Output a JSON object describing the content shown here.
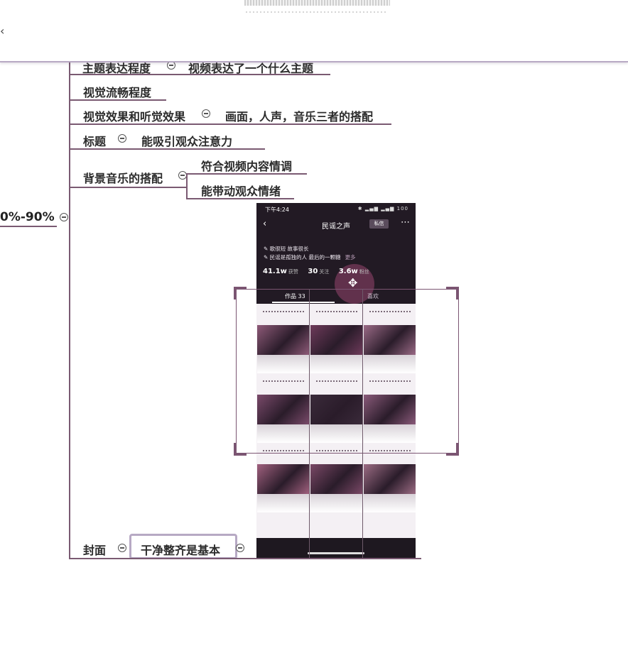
{
  "toolbar": {
    "back_glyph": "‹"
  },
  "mindmap": {
    "root_label": "0%-90%",
    "items": [
      {
        "label": "主题表达程度",
        "child": "视频表达了一个什么主题"
      },
      {
        "label": "视觉流畅程度"
      },
      {
        "label": "视觉效果和听觉效果",
        "child": "画面，人声，音乐三者的搭配"
      },
      {
        "label": "标题",
        "child": "能吸引观众注意力"
      },
      {
        "label": "背景音乐的搭配",
        "children": [
          "符合视频内容情调",
          "能带动观众情绪"
        ]
      },
      {
        "label": "封面",
        "child": "干净整齐是基本"
      }
    ]
  },
  "phone": {
    "status_time": "下午4:24",
    "status_icons": "✱ ▂▄▆ ▂▄▆ 100",
    "title": "民谣之声",
    "message_button": "私信",
    "bio_lines": [
      "歌很短 故事很长",
      "民谣是孤独的人 最后的一颗糖"
    ],
    "bio_more": "更多",
    "likes_value": "41.1w",
    "likes_label": "获赞",
    "following_value": "30",
    "following_label": "关注",
    "fans_value": "3.6w",
    "fans_label": "粉丝",
    "tab_works": "作品 33",
    "tab_likes": "喜欢",
    "thumb_colors": [
      "#8e5a78",
      "#6e3a5a",
      "#9a6a86",
      "#7a4a6a",
      "#3a2a3a",
      "#8a5a7a",
      "#a0607e",
      "#7a4866",
      "#9c6c84"
    ]
  }
}
